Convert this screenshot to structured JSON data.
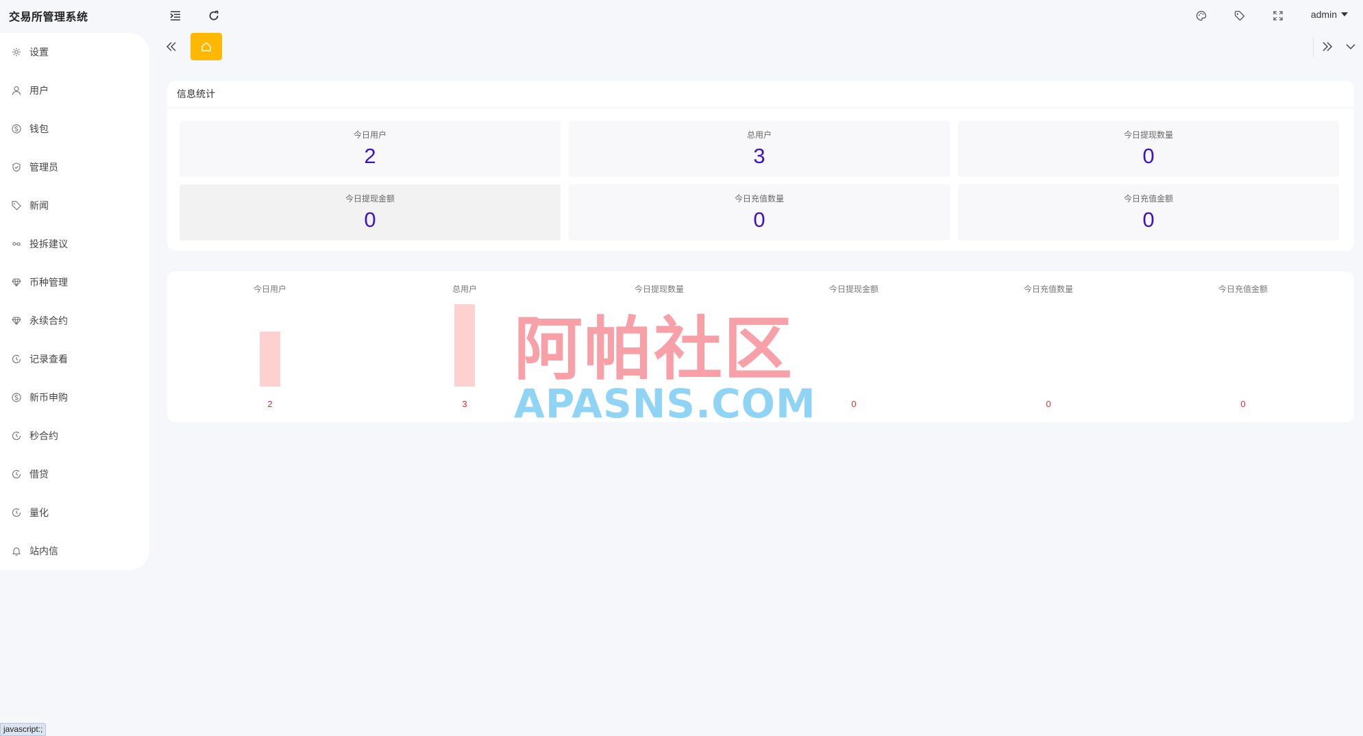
{
  "app": {
    "title": "交易所管理系统"
  },
  "header": {
    "icons": [
      "indent-icon",
      "refresh-icon",
      "palette-icon",
      "tag-icon",
      "fullscreen-icon"
    ],
    "user": "admin"
  },
  "sidebar": {
    "items": [
      {
        "label": "设置",
        "icon": "gear-icon"
      },
      {
        "label": "用户",
        "icon": "user-icon"
      },
      {
        "label": "钱包",
        "icon": "dollar-icon"
      },
      {
        "label": "管理员",
        "icon": "shield-icon"
      },
      {
        "label": "新闻",
        "icon": "tag-icon"
      },
      {
        "label": "投拆建议",
        "icon": "link-icon"
      },
      {
        "label": "币种管理",
        "icon": "diamond-icon"
      },
      {
        "label": "永续合约",
        "icon": "diamond-icon"
      },
      {
        "label": "记录查看",
        "icon": "record-icon"
      },
      {
        "label": "新币申购",
        "icon": "dollar-icon"
      },
      {
        "label": "秒合约",
        "icon": "record-icon"
      },
      {
        "label": "借贷",
        "icon": "record-icon"
      },
      {
        "label": "量化",
        "icon": "record-icon"
      },
      {
        "label": "站内信",
        "icon": "bell-icon"
      }
    ]
  },
  "tabs": {
    "active": "home"
  },
  "stats": {
    "title": "信息统计",
    "cards": [
      {
        "label": "今日用户",
        "value": "2"
      },
      {
        "label": "总用户",
        "value": "3"
      },
      {
        "label": "今日提现数量",
        "value": "0"
      },
      {
        "label": "今日提现金额",
        "value": "0"
      },
      {
        "label": "今日充值数量",
        "value": "0"
      },
      {
        "label": "今日充值金额",
        "value": "0"
      }
    ]
  },
  "chart_data": {
    "type": "bar",
    "categories": [
      "今日用户",
      "总用户",
      "今日提现数量",
      "今日提现金额",
      "今日充值数量",
      "今日充值金额"
    ],
    "values": [
      2,
      3,
      0,
      0,
      0,
      0
    ],
    "labels": [
      "2",
      "3",
      "0",
      "0",
      "0",
      "0"
    ],
    "ylim": [
      0,
      3
    ],
    "bar_color": "#ffd0d0",
    "label_color": "#e82a2a"
  },
  "watermark": {
    "cn": "阿帕社区",
    "en": "APASNS.COM"
  },
  "statusbar": {
    "text": "javascript:;"
  },
  "colors": {
    "accent": "#ffb800",
    "value": "#3c14c8"
  }
}
